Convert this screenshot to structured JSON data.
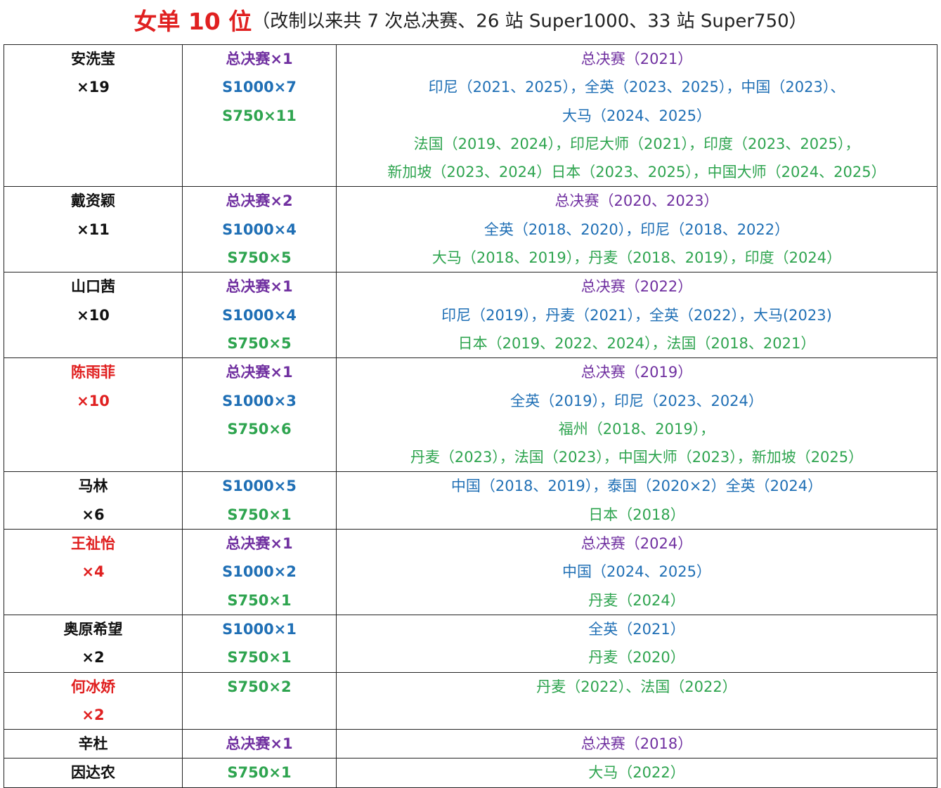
{
  "title": {
    "main": "女单 10 位",
    "sub": "（改制以来共 7 次总决赛、26 站 Super1000、33 站 Super750）"
  },
  "colors": {
    "title_red": "#e02020",
    "highlight_name": "#e02020",
    "finals": "#7030a0",
    "s1000": "#1f6fb5",
    "s750": "#2ea44f",
    "text": "#111111"
  },
  "rows": [
    {
      "name": "安洗莹",
      "total": "×19",
      "highlight": false,
      "counts": [
        {
          "text": "总决赛×1",
          "cls": "purple"
        },
        {
          "text": "S1000×7",
          "cls": "blue"
        },
        {
          "text": "S750×11",
          "cls": "green"
        }
      ],
      "details": [
        {
          "text": "总决赛（2021）",
          "cls": "purple"
        },
        {
          "text": "印尼（2021、2025），全英（2023、2025），中国（2023）、",
          "cls": "blue"
        },
        {
          "text": "大马（2024、2025）",
          "cls": "blue"
        },
        {
          "text": "法国（2019、2024），印尼大师（2021），印度（2023、2025），",
          "cls": "green"
        },
        {
          "text": "新加坡（2023、2024）日本（2023、2025），中国大师（2024、2025）",
          "cls": "green"
        }
      ]
    },
    {
      "name": "戴资颖",
      "total": "×11",
      "highlight": false,
      "counts": [
        {
          "text": "总决赛×2",
          "cls": "purple"
        },
        {
          "text": "S1000×4",
          "cls": "blue"
        },
        {
          "text": "S750×5",
          "cls": "green"
        }
      ],
      "details": [
        {
          "text": "总决赛（2020、2023）",
          "cls": "purple"
        },
        {
          "text": "全英（2018、2020），印尼（2018、2022）",
          "cls": "blue"
        },
        {
          "text": "大马（2018、2019），丹麦（2018、2019），印度（2024）",
          "cls": "green"
        }
      ]
    },
    {
      "name": "山口茜",
      "total": "×10",
      "highlight": false,
      "counts": [
        {
          "text": "总决赛×1",
          "cls": "purple"
        },
        {
          "text": "S1000×4",
          "cls": "blue"
        },
        {
          "text": "S750×5",
          "cls": "green"
        }
      ],
      "details": [
        {
          "text": "总决赛（2022）",
          "cls": "purple"
        },
        {
          "text": "印尼（2019），丹麦（2021），全英（2022），大马(2023)",
          "cls": "blue"
        },
        {
          "text": "日本（2019、2022、2024），法国（2018、2021）",
          "cls": "green"
        }
      ]
    },
    {
      "name": "陈雨菲",
      "total": "×10",
      "highlight": true,
      "counts": [
        {
          "text": "总决赛×1",
          "cls": "purple"
        },
        {
          "text": "S1000×3",
          "cls": "blue"
        },
        {
          "text": "S750×6",
          "cls": "green"
        }
      ],
      "details": [
        {
          "text": "总决赛（2019）",
          "cls": "purple"
        },
        {
          "text": "全英（2019），印尼（2023、2024）",
          "cls": "blue"
        },
        {
          "text": "福州（2018、2019），",
          "cls": "green"
        },
        {
          "text": "丹麦（2023），法国（2023），中国大师（2023），新加坡（2025）",
          "cls": "green"
        }
      ]
    },
    {
      "name": "马林",
      "total": "×6",
      "highlight": false,
      "counts": [
        {
          "text": "S1000×5",
          "cls": "blue"
        },
        {
          "text": "S750×1",
          "cls": "green"
        }
      ],
      "details": [
        {
          "text": "中国（2018、2019），泰国（2020×2）全英（2024）",
          "cls": "blue"
        },
        {
          "text": "日本（2018）",
          "cls": "green"
        }
      ]
    },
    {
      "name": "王祉怡",
      "total": "×4",
      "highlight": true,
      "counts": [
        {
          "text": "总决赛×1",
          "cls": "purple"
        },
        {
          "text": "S1000×2",
          "cls": "blue"
        },
        {
          "text": "S750×1",
          "cls": "green"
        }
      ],
      "details": [
        {
          "text": "总决赛（2024）",
          "cls": "purple"
        },
        {
          "text": "中国（2024、2025）",
          "cls": "blue"
        },
        {
          "text": "丹麦（2024）",
          "cls": "green"
        }
      ]
    },
    {
      "name": "奥原希望",
      "total": "×2",
      "highlight": false,
      "counts": [
        {
          "text": "S1000×1",
          "cls": "blue"
        },
        {
          "text": "S750×1",
          "cls": "green"
        }
      ],
      "details": [
        {
          "text": "全英（2021）",
          "cls": "blue"
        },
        {
          "text": "丹麦（2020）",
          "cls": "green"
        }
      ]
    },
    {
      "name": "何冰娇",
      "total": "×2",
      "highlight": true,
      "counts": [
        {
          "text": "S750×2",
          "cls": "green"
        }
      ],
      "details": [
        {
          "text": "丹麦（2022）、法国（2022）",
          "cls": "green"
        }
      ]
    },
    {
      "name": "辛杜",
      "total": "",
      "highlight": false,
      "counts": [
        {
          "text": "总决赛×1",
          "cls": "purple"
        }
      ],
      "details": [
        {
          "text": "总决赛（2018）",
          "cls": "purple"
        }
      ]
    },
    {
      "name": "因达农",
      "total": "",
      "highlight": false,
      "counts": [
        {
          "text": "S750×1",
          "cls": "green"
        }
      ],
      "details": [
        {
          "text": "大马（2022）",
          "cls": "green"
        }
      ]
    }
  ]
}
